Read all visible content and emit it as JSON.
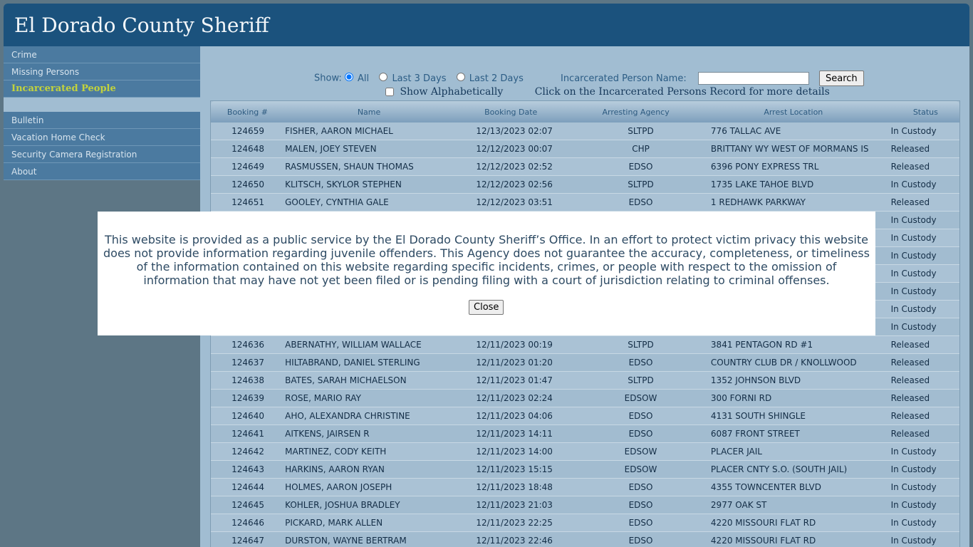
{
  "header": {
    "title": "El Dorado County Sheriff"
  },
  "sidebar": {
    "group1": [
      {
        "label": "Crime"
      },
      {
        "label": "Missing Persons"
      },
      {
        "label": "Incarcerated People"
      }
    ],
    "group2": [
      {
        "label": "Bulletin"
      },
      {
        "label": "Vacation Home Check"
      },
      {
        "label": "Security Camera Registration"
      },
      {
        "label": "About"
      }
    ]
  },
  "controls": {
    "show_label": "Show:",
    "opt_all": "All",
    "opt_3": "Last 3 Days",
    "opt_2": "Last 2 Days",
    "name_label": "Incarcerated Person Name:",
    "name_value": "",
    "search_label": "Search",
    "alpha_label": "Show Alphabetically",
    "hint": "Click on the Incarcerated Persons Record for more details"
  },
  "table": {
    "headers": [
      "Booking #",
      "Name",
      "Booking Date",
      "Arresting Agency",
      "Arrest Location",
      "Status"
    ],
    "rows": [
      [
        "124659",
        "FISHER, AARON MICHAEL",
        "12/13/2023 02:07",
        "SLTPD",
        "776 TALLAC AVE",
        "In Custody"
      ],
      [
        "124648",
        "MALEN, JOEY STEVEN",
        "12/12/2023 00:07",
        "CHP",
        "BRITTANY WY WEST OF MORMANS IS",
        "Released"
      ],
      [
        "124649",
        "RASMUSSEN, SHAUN THOMAS",
        "12/12/2023 02:52",
        "EDSO",
        "6396 PONY EXPRESS TRL",
        "Released"
      ],
      [
        "124650",
        "KLITSCH, SKYLOR STEPHEN",
        "12/12/2023 02:56",
        "SLTPD",
        "1735 LAKE TAHOE BLVD",
        "In Custody"
      ],
      [
        "124651",
        "GOOLEY, CYNTHIA GALE",
        "12/12/2023 03:51",
        "EDSO",
        "1 REDHAWK PARKWAY",
        "Released"
      ],
      [
        "",
        "",
        "",
        "",
        "",
        "In Custody"
      ],
      [
        "",
        "",
        "",
        "",
        "",
        "In Custody"
      ],
      [
        "",
        "",
        "",
        "",
        "",
        "In Custody"
      ],
      [
        "",
        "",
        "",
        "",
        "",
        "In Custody"
      ],
      [
        "",
        "",
        "",
        "",
        "",
        "In Custody"
      ],
      [
        "",
        "",
        "",
        "",
        "",
        "In Custody"
      ],
      [
        "",
        "",
        "",
        "",
        "",
        "In Custody"
      ],
      [
        "124636",
        "ABERNATHY, WILLIAM WALLACE",
        "12/11/2023 00:19",
        "SLTPD",
        "3841 PENTAGON RD #1",
        "Released"
      ],
      [
        "124637",
        "HILTABRAND, DANIEL STERLING",
        "12/11/2023 01:20",
        "EDSO",
        "COUNTRY CLUB DR / KNOLLWOOD",
        "Released"
      ],
      [
        "124638",
        "BATES, SARAH MICHAELSON",
        "12/11/2023 01:47",
        "SLTPD",
        "1352 JOHNSON BLVD",
        "Released"
      ],
      [
        "124639",
        "ROSE, MARIO RAY",
        "12/11/2023 02:24",
        "EDSOW",
        "300 FORNI RD",
        "Released"
      ],
      [
        "124640",
        "AHO, ALEXANDRA CHRISTINE",
        "12/11/2023 04:06",
        "EDSO",
        "4131 SOUTH SHINGLE",
        "Released"
      ],
      [
        "124641",
        "AITKENS, JAIRSEN R",
        "12/11/2023 14:11",
        "EDSO",
        "6087 FRONT STREET",
        "Released"
      ],
      [
        "124642",
        "MARTINEZ, CODY KEITH",
        "12/11/2023 14:00",
        "EDSOW",
        "PLACER JAIL",
        "In Custody"
      ],
      [
        "124643",
        "HARKINS, AARON RYAN",
        "12/11/2023 15:15",
        "EDSOW",
        "PLACER CNTY S.O. (SOUTH JAIL)",
        "In Custody"
      ],
      [
        "124644",
        "HOLMES, AARON JOSEPH",
        "12/11/2023 18:48",
        "EDSO",
        "4355 TOWNCENTER BLVD",
        "In Custody"
      ],
      [
        "124645",
        "KOHLER, JOSHUA BRADLEY",
        "12/11/2023 21:03",
        "EDSO",
        "2977 OAK ST",
        "In Custody"
      ],
      [
        "124646",
        "PICKARD, MARK ALLEN",
        "12/11/2023 22:25",
        "EDSO",
        "4220 MISSOURI FLAT RD",
        "In Custody"
      ],
      [
        "124647",
        "DURSTON, WAYNE BERTRAM",
        "12/11/2023 22:46",
        "EDSO",
        "4220 MISSOURI FLAT RD",
        "In Custody"
      ]
    ]
  },
  "modal": {
    "text": "This website is provided as a public service by the El Dorado County Sheriff’s Office. In an effort to protect victim privacy this website does not provide information regarding juvenile offenders. This Agency does not guarantee the accuracy, completeness, or timeliness of the information contained on this website regarding specific incidents, crimes, or people with respect to the omission of information that may have not yet been filed or is pending filing with a court of jurisdiction relating to criminal offenses.",
    "close_label": "Close"
  },
  "colors": {
    "header_bg": "#1b527d",
    "nav_bg": "#4b7aa0",
    "active_nav": "#c3d33c",
    "content_bg": "#a1bdd2"
  }
}
